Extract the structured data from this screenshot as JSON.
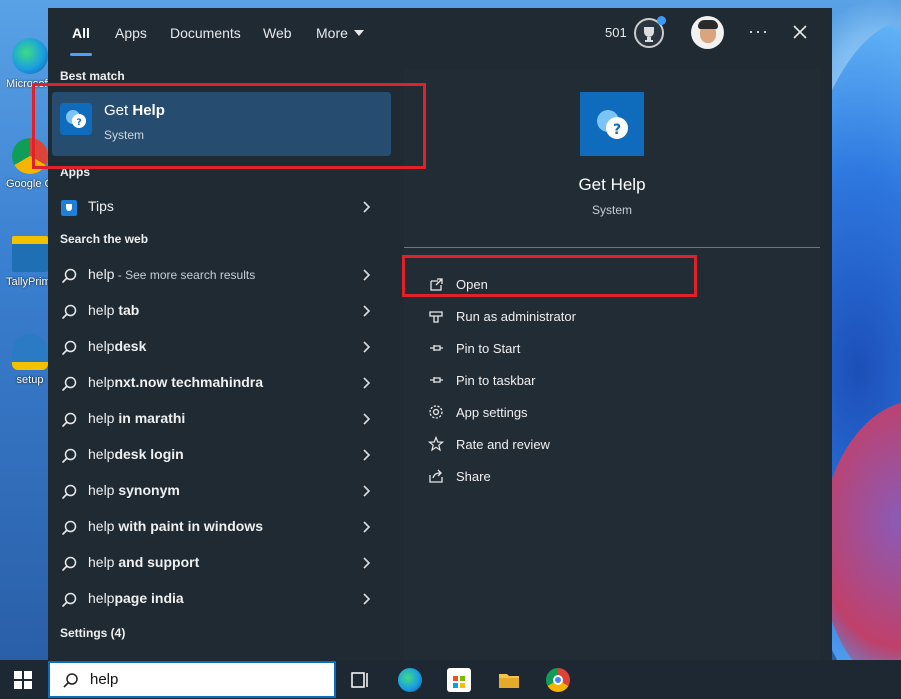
{
  "desktop": {
    "icons": [
      {
        "label": "Microsoft Edge",
        "icon": "edge-icon"
      },
      {
        "label": "Google Chrome",
        "icon": "chrome-icon"
      },
      {
        "label": "TallyPrime Edit Log",
        "icon": "tally-icon"
      },
      {
        "label": "setup",
        "icon": "setup-icon"
      }
    ]
  },
  "topbar": {
    "tabs": [
      "All",
      "Apps",
      "Documents",
      "Web",
      "More"
    ],
    "active_tab": "All",
    "points": "501"
  },
  "best_match": {
    "section": "Best match",
    "title_prefix": "Get ",
    "title_bold": "Help",
    "subtitle": "System"
  },
  "apps": {
    "section": "Apps",
    "items": [
      {
        "label": "Tips",
        "icon": "tips-icon"
      }
    ]
  },
  "web": {
    "section": "Search the web",
    "items": [
      {
        "prefix": "help",
        "bold": "",
        "muted": " - See more search results"
      },
      {
        "prefix": "help",
        "bold": " tab",
        "muted": ""
      },
      {
        "prefix": "help",
        "bold": "desk",
        "muted": ""
      },
      {
        "prefix": "help",
        "bold": "nxt.now techmahindra",
        "muted": ""
      },
      {
        "prefix": "help",
        "bold": " in marathi",
        "muted": ""
      },
      {
        "prefix": "help",
        "bold": "desk login",
        "muted": ""
      },
      {
        "prefix": "help",
        "bold": " synonym",
        "muted": ""
      },
      {
        "prefix": "help",
        "bold": " with paint in windows",
        "muted": ""
      },
      {
        "prefix": "help",
        "bold": " and support",
        "muted": ""
      },
      {
        "prefix": "help",
        "bold": "page india",
        "muted": ""
      }
    ]
  },
  "settings": {
    "section": "Settings (4)"
  },
  "details": {
    "title": "Get Help",
    "subtitle": "System",
    "actions": [
      {
        "label": "Open",
        "icon": "open-icon"
      },
      {
        "label": "Run as administrator",
        "icon": "shield-icon"
      },
      {
        "label": "Pin to Start",
        "icon": "pin-icon"
      },
      {
        "label": "Pin to taskbar",
        "icon": "pin-icon"
      },
      {
        "label": "App settings",
        "icon": "gear-icon"
      },
      {
        "label": "Rate and review",
        "icon": "star-icon"
      },
      {
        "label": "Share",
        "icon": "share-icon"
      }
    ]
  },
  "taskbar": {
    "search_value": "help",
    "icons": [
      "task-view-icon",
      "edge-icon",
      "store-icon",
      "file-explorer-icon",
      "chrome-icon"
    ]
  },
  "colors": {
    "accent": "#0f6cbd",
    "highlight_box": "#e0212b",
    "panel_bg": "#1f2a33"
  }
}
